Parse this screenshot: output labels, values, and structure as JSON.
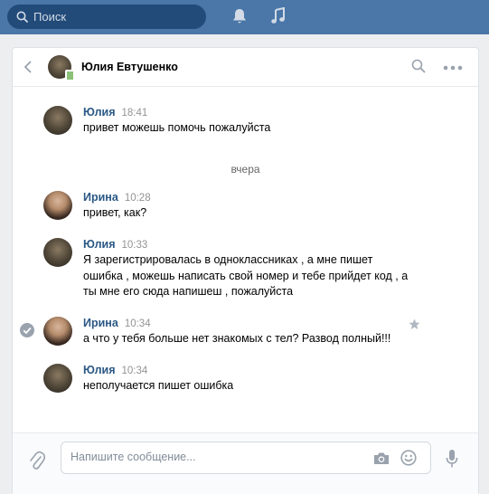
{
  "topbar": {
    "search_placeholder": "Поиск",
    "icons": [
      "search-icon",
      "bell-icon",
      "music-icon"
    ],
    "bg_color": "#4a76a8"
  },
  "dialog": {
    "contact_name": "Юлия Евтушенко",
    "online": true
  },
  "messages": [
    {
      "author": "Юлия",
      "time": "18:41",
      "lines": [
        "привет можешь помочь пожалуйста"
      ]
    },
    {
      "author": "Ирина",
      "time": "10:28",
      "lines": [
        "привет, как?"
      ]
    },
    {
      "author": "Юлия",
      "time": "10:33",
      "lines": [
        "Я зарегистрировалась в одноклассниках , а мне пишет",
        "ошибка , можешь написать свой номер и тебе прийдет код , а",
        "ты мне его сюда напишеш , пожалуйста"
      ]
    },
    {
      "author": "Ирина",
      "time": "10:34",
      "lines": [
        "а что у тебя больше нет знакомых с тел? Развод полный!!!"
      ],
      "selected": true
    },
    {
      "author": "Юлия",
      "time": "10:34",
      "lines": [
        "неполучается пишет ошибка"
      ]
    }
  ],
  "day_divider": "вчера",
  "composer": {
    "placeholder": "Напишите сообщение..."
  },
  "colors": {
    "link": "#2a5885",
    "time": "#939393",
    "online": "#8ac176"
  }
}
